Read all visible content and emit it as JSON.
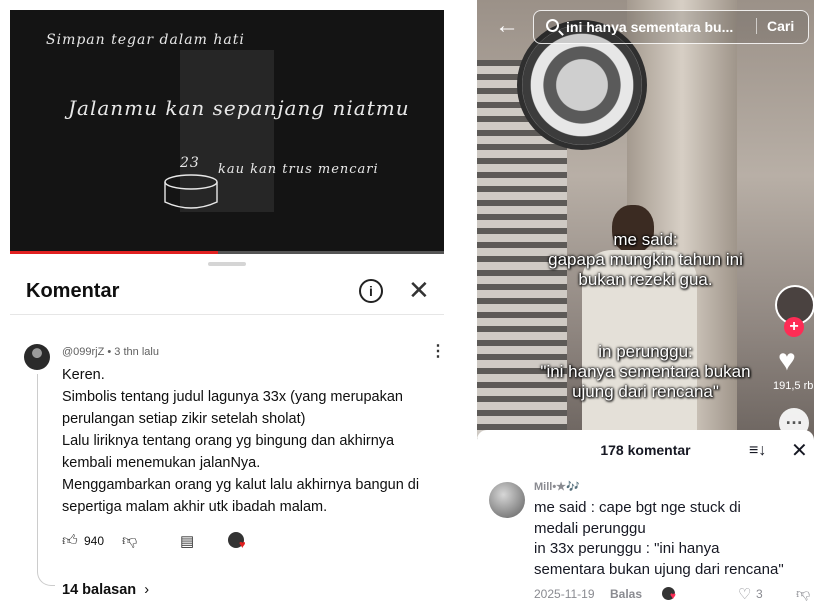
{
  "left": {
    "video": {
      "lyrics": [
        "Simpan tegar dalam hati",
        "Jalanmu kan sepanjang niatmu",
        "kau kan trus mencari"
      ],
      "cake_number": "23",
      "progress_fraction": 0.48
    },
    "comments_sheet": {
      "title": "Komentar",
      "comment": {
        "meta": "@099rjZ • 3 thn lalu",
        "lines": [
          "Keren.",
          "Simbolis tentang judul lagunya 33x (yang merupakan",
          "perulangan setiap zikir setelah sholat)",
          "Lalu liriknya tentang orang yg bingung dan akhirnya",
          "kembali menemukan jalanNya.",
          "Menggambarkan orang yg kalut lalu akhirnya bangun di",
          "sepertiga malam akhir utk ibadah malam."
        ],
        "likes": "940"
      },
      "replies_label": "14 balasan"
    }
  },
  "right": {
    "search": {
      "query": "ini hanya sementara bu...",
      "button": "Cari"
    },
    "captions": {
      "top": [
        "me said:",
        "gapapa mungkin tahun ini",
        "bukan rezeki gua."
      ],
      "bottom": [
        "in perunggu:",
        "\"ini hanya sementara bukan",
        "ujung dari rencana\""
      ]
    },
    "likes": "191,5 rb",
    "comments": {
      "count_label": "178 komentar",
      "comment": {
        "user": "Mill•★🎶",
        "lines": [
          "me said : cape bgt nge stuck di",
          "medali perunggu",
          "in 33x perunggu : \"ini hanya",
          "sementara bukan ujung dari rencana\""
        ],
        "date": "2025-11-19",
        "reply_label": "Balas",
        "likes": "3"
      }
    }
  },
  "colors": {
    "accent_red": "#e02020",
    "tiktok_pink": "#fe2c55"
  },
  "icons": [
    "info-icon",
    "close-icon",
    "thumbs-up-icon",
    "thumbs-down-icon",
    "reply-icon",
    "back-arrow-icon",
    "search-icon",
    "heart-icon",
    "sort-icon"
  ]
}
